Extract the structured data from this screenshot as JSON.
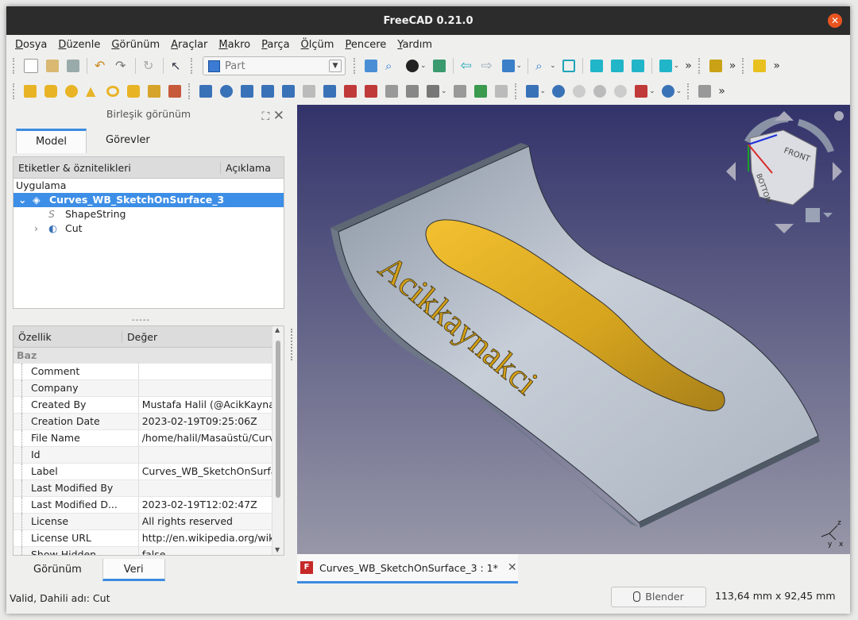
{
  "window": {
    "title": "FreeCAD 0.21.0",
    "close_glyph": "✕"
  },
  "menu": [
    "Dosya",
    "Düzenle",
    "Görünüm",
    "Araçlar",
    "Makro",
    "Parça",
    "Ölçüm",
    "Pencere",
    "Yardım"
  ],
  "workbench": {
    "selected": "Part"
  },
  "combo_view": {
    "title": "Birleşik görünüm",
    "tabs": [
      "Model",
      "Görevler"
    ],
    "tree": {
      "headers": [
        "Etiketler & öznitelikleri",
        "Açıklama"
      ],
      "group": "Uygulama",
      "items": [
        {
          "label": "Curves_WB_SketchOnSurface_3",
          "expander": "⌄",
          "icon_char": "◈"
        },
        {
          "label": "ShapeString",
          "expander": "",
          "icon_char": "S"
        },
        {
          "label": "Cut",
          "expander": "›",
          "icon_char": "◐"
        }
      ]
    },
    "splitter": "-----",
    "properties": {
      "headers": [
        "Özellik",
        "Değer"
      ],
      "group": "Baz",
      "rows": [
        [
          "Comment",
          ""
        ],
        [
          "Company",
          ""
        ],
        [
          "Created By",
          "Mustafa Halil (@AcikKaynak..."
        ],
        [
          "Creation Date",
          "2023-02-19T09:25:06Z"
        ],
        [
          "File Name",
          "/home/halil/Masaüstü/Curve..."
        ],
        [
          "Id",
          ""
        ],
        [
          "Label",
          "Curves_WB_SketchOnSurfa..."
        ],
        [
          "Last Modified By",
          ""
        ],
        [
          "Last Modified D...",
          "2023-02-19T12:02:47Z"
        ],
        [
          "License",
          "All rights reserved"
        ],
        [
          "License URL",
          "http://en.wikipedia.org/wiki/..."
        ],
        [
          "Show Hidden",
          "false"
        ]
      ]
    },
    "bottom_tabs": [
      "Görünüm",
      "Veri"
    ]
  },
  "viewport": {
    "engraved_text": "Acikkaynakci",
    "navcube_face": "FRONT",
    "navcube_face_bottom": "BOTTOM",
    "axis_labels": [
      "z",
      "y",
      "x"
    ]
  },
  "document_tab": {
    "label": "Curves_WB_SketchOnSurface_3 : 1*",
    "close_glyph": "✕"
  },
  "status": {
    "message": "Valid, Dahili adı: Cut",
    "nav_style": "Blender",
    "dimensions": "113,64 mm x 92,45 mm"
  },
  "colors": {
    "accent": "#3c8be0",
    "selection": "#3d8ee6",
    "titlebar": "#2c2c2c",
    "close": "#e95420",
    "part_yellow": "#e8b426"
  }
}
